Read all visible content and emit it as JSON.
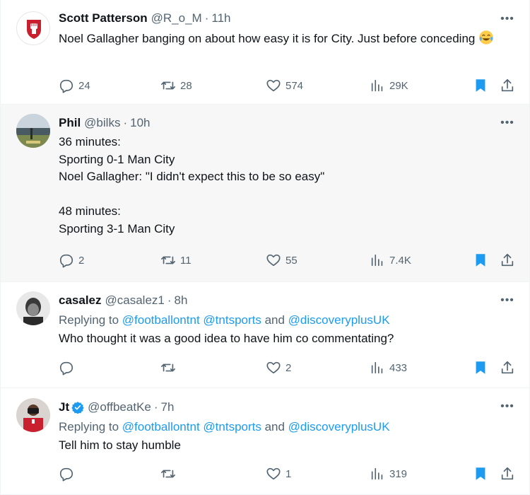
{
  "tweets": [
    {
      "name": "Scott Patterson",
      "handle": "@R_o_M",
      "dot": "·",
      "time": "11h",
      "text": "Noel Gallagher banging on about how easy it is for City. Just before conceding",
      "emoji": "face-with-tears-of-joy",
      "replies": "24",
      "retweets": "28",
      "likes": "574",
      "views": "29K"
    },
    {
      "name": "Phil",
      "handle": "@bilks",
      "dot": "·",
      "time": "10h",
      "text": "36 minutes:\nSporting 0-1 Man City\nNoel Gallagher: \"I didn't expect this to be so easy\"\n\n48 minutes:\nSporting 3-1 Man City",
      "replies": "2",
      "retweets": "11",
      "likes": "55",
      "views": "7.4K"
    },
    {
      "name": "casalez",
      "handle": "@casalez1",
      "dot": "·",
      "time": "8h",
      "reply_prefix": "Replying to ",
      "mention_1": "@footballontnt",
      "mention_2": "@tntsports",
      "reply_and": " and ",
      "mention_3": "@discoveryplusUK",
      "text": "Who thought it was a good idea to have him co commentating?",
      "replies": "",
      "retweets": "",
      "likes": "2",
      "views": "433"
    },
    {
      "name": "Jt",
      "handle": "@offbeatKe",
      "dot": "·",
      "time": "7h",
      "reply_prefix": "Replying to ",
      "mention_1": "@footballontnt",
      "mention_2": "@tntsports",
      "reply_and": " and ",
      "mention_3": "@discoveryplusUK",
      "text": "Tell him to stay humble",
      "replies": "",
      "retweets": "",
      "likes": "1",
      "views": "319"
    }
  ],
  "colors": {
    "text": "#0f1419",
    "muted": "#536471",
    "link": "#1d9bf0",
    "bookmark": "#1d9bf0",
    "highlight_bg": "#f7f7f7"
  }
}
